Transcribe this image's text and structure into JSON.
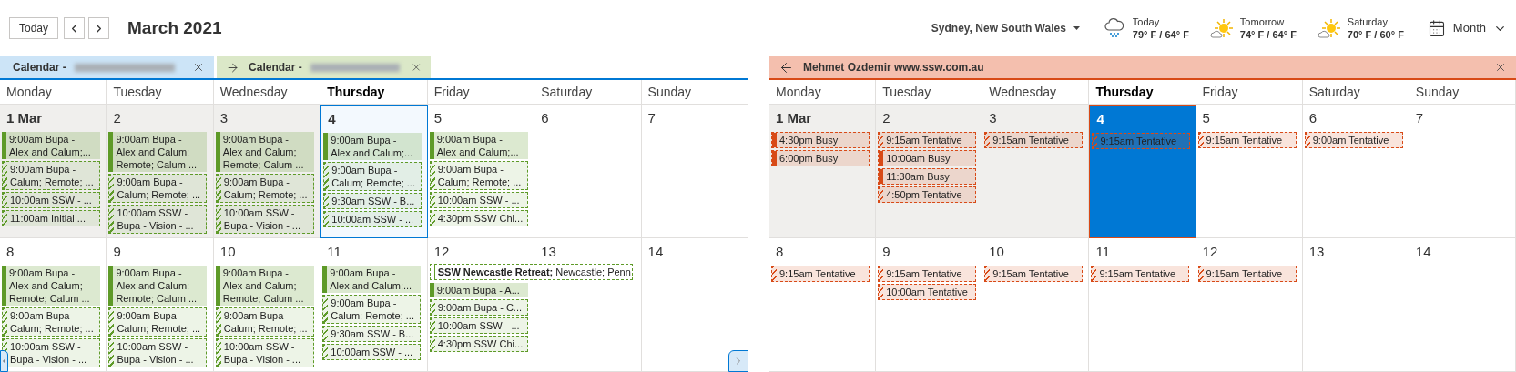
{
  "toolbar": {
    "today_button": "Today",
    "title": "March 2021",
    "location": "Sydney, New South Wales",
    "view": "Month",
    "weather": [
      {
        "kind": "rain",
        "day": "Today",
        "temps": "79° F / 64° F"
      },
      {
        "kind": "sun-cloud",
        "day": "Tomorrow",
        "temps": "74° F / 64° F"
      },
      {
        "kind": "sun-cloud",
        "day": "Saturday",
        "temps": "70° F / 60° F"
      }
    ]
  },
  "calendars": [
    {
      "kind": "overlay",
      "color": "#5e9a28",
      "tabs": [
        {
          "label": "Calendar - ",
          "color": "#cce4f7",
          "arrow": false,
          "redacted": true
        },
        {
          "label": "Calendar - ",
          "color": "#dbe8c8",
          "arrow": true,
          "redacted": true
        }
      ],
      "weekdays": [
        {
          "label": "Monday",
          "today": false
        },
        {
          "label": "Tuesday",
          "today": false
        },
        {
          "label": "Wednesday",
          "today": false
        },
        {
          "label": "Thursday",
          "today": true
        },
        {
          "label": "Friday",
          "today": false
        },
        {
          "label": "Saturday",
          "today": false
        },
        {
          "label": "Sunday",
          "today": false
        }
      ],
      "weeks": [
        [
          {
            "date": "1 Mar",
            "month_start": true,
            "past": true,
            "today": false,
            "events": [
              {
                "kind": "solid",
                "text": "9:00am Bupa -\nAlex and Calum;..."
              },
              {
                "kind": "tentative",
                "text": "9:00am Bupa -\nCalum; Remote; ..."
              },
              {
                "kind": "tentative",
                "text": "10:00am SSW - ..."
              },
              {
                "kind": "tentative",
                "text": "11:00am Initial ..."
              }
            ]
          },
          {
            "date": "2",
            "month_start": false,
            "past": true,
            "today": false,
            "events": [
              {
                "kind": "solid",
                "text": "9:00am Bupa -\nAlex and Calum;\nRemote; Calum ..."
              },
              {
                "kind": "tentative",
                "text": "9:00am Bupa -\nCalum; Remote; ..."
              },
              {
                "kind": "tentative",
                "text": "10:00am SSW -\nBupa - Vision - ..."
              }
            ]
          },
          {
            "date": "3",
            "month_start": false,
            "past": true,
            "today": false,
            "events": [
              {
                "kind": "solid",
                "text": "9:00am Bupa -\nAlex and Calum;\nRemote; Calum ..."
              },
              {
                "kind": "tentative",
                "text": "9:00am Bupa -\nCalum; Remote; ..."
              },
              {
                "kind": "tentative",
                "text": "10:00am SSW -\nBupa - Vision - ..."
              }
            ]
          },
          {
            "date": "4",
            "month_start": false,
            "past": false,
            "today": true,
            "events": [
              {
                "kind": "solid",
                "text": "9:00am Bupa -\nAlex and Calum;..."
              },
              {
                "kind": "tentative",
                "text": "9:00am Bupa -\nCalum; Remote; ..."
              },
              {
                "kind": "tentative",
                "text": "9:30am SSW - B..."
              },
              {
                "kind": "tentative",
                "text": "10:00am SSW - ..."
              }
            ]
          },
          {
            "date": "5",
            "month_start": false,
            "past": false,
            "today": false,
            "events": [
              {
                "kind": "solid",
                "text": "9:00am Bupa -\nAlex and Calum;..."
              },
              {
                "kind": "tentative",
                "text": "9:00am Bupa -\nCalum; Remote; ..."
              },
              {
                "kind": "tentative",
                "text": "10:00am SSW - ..."
              },
              {
                "kind": "tentative",
                "text": "4:30pm SSW Chi..."
              }
            ]
          },
          {
            "date": "6",
            "month_start": false,
            "past": false,
            "today": false
          },
          {
            "date": "7",
            "month_start": false,
            "past": false,
            "today": false
          }
        ],
        [
          {
            "date": "8",
            "month_start": false,
            "past": false,
            "today": false,
            "events": [
              {
                "kind": "solid",
                "text": "9:00am Bupa -\nAlex and Calum;\nRemote; Calum ..."
              },
              {
                "kind": "tentative",
                "text": "9:00am Bupa -\nCalum; Remote; ..."
              },
              {
                "kind": "tentative",
                "text": "10:00am SSW -\nBupa - Vision - ..."
              }
            ]
          },
          {
            "date": "9",
            "month_start": false,
            "past": false,
            "today": false,
            "events": [
              {
                "kind": "solid",
                "text": "9:00am Bupa -\nAlex and Calum;\nRemote; Calum ..."
              },
              {
                "kind": "tentative",
                "text": "9:00am Bupa -\nCalum; Remote; ..."
              },
              {
                "kind": "tentative",
                "text": "10:00am SSW -\nBupa - Vision - ..."
              }
            ]
          },
          {
            "date": "10",
            "month_start": false,
            "past": false,
            "today": false,
            "events": [
              {
                "kind": "solid",
                "text": "9:00am Bupa -\nAlex and Calum;\nRemote; Calum ..."
              },
              {
                "kind": "tentative",
                "text": "9:00am Bupa -\nCalum; Remote; ..."
              },
              {
                "kind": "tentative",
                "text": "10:00am SSW -\nBupa - Vision - ..."
              }
            ]
          },
          {
            "date": "11",
            "month_start": false,
            "past": false,
            "today": false,
            "events": [
              {
                "kind": "solid",
                "text": "9:00am Bupa -\nAlex and Calum;..."
              },
              {
                "kind": "tentative",
                "text": "9:00am Bupa -\nCalum; Remote; ..."
              },
              {
                "kind": "tentative",
                "text": "9:30am SSW - B..."
              },
              {
                "kind": "tentative",
                "text": "10:00am SSW - ..."
              }
            ]
          },
          {
            "date": "12",
            "month_start": false,
            "past": false,
            "today": false,
            "events": [
              {
                "kind": "allday",
                "text": "**SSW Newcastle Retreat;** Newcastle; Penn"
              },
              {
                "kind": "solid",
                "text": "9:00am Bupa - A..."
              },
              {
                "kind": "tentative",
                "text": "9:00am Bupa - C..."
              },
              {
                "kind": "tentative",
                "text": "10:00am SSW - ..."
              },
              {
                "kind": "tentative",
                "text": "4:30pm SSW Chi..."
              }
            ]
          },
          {
            "date": "13",
            "month_start": false,
            "past": false,
            "today": false
          },
          {
            "date": "14",
            "month_start": false,
            "past": false,
            "today": false
          }
        ]
      ]
    },
    {
      "kind": "shared",
      "color": "#d84a17",
      "tabs": [
        {
          "label": "Mehmet Ozdemir www.ssw.com.au",
          "color": "#f4bfae",
          "arrow": true,
          "redacted": false
        }
      ],
      "weekdays": [
        {
          "label": "Monday",
          "today": false
        },
        {
          "label": "Tuesday",
          "today": false
        },
        {
          "label": "Wednesday",
          "today": false
        },
        {
          "label": "Thursday",
          "today": true
        },
        {
          "label": "Friday",
          "today": false
        },
        {
          "label": "Saturday",
          "today": false
        },
        {
          "label": "Sunday",
          "today": false
        }
      ],
      "weeks": [
        [
          {
            "date": "1 Mar",
            "month_start": true,
            "past": true,
            "today": false,
            "events": [
              {
                "kind": "busy",
                "text": "4:30pm Busy"
              },
              {
                "kind": "busy",
                "text": "6:00pm Busy"
              }
            ]
          },
          {
            "date": "2",
            "month_start": false,
            "past": true,
            "today": false,
            "events": [
              {
                "kind": "tentative",
                "text": "9:15am Tentative"
              },
              {
                "kind": "busy",
                "text": "10:00am Busy"
              },
              {
                "kind": "busy",
                "text": "11:30am Busy"
              },
              {
                "kind": "tentative",
                "text": "4:50pm Tentative"
              }
            ]
          },
          {
            "date": "3",
            "month_start": false,
            "past": true,
            "today": false,
            "events": [
              {
                "kind": "tentative",
                "text": "9:15am Tentative"
              }
            ]
          },
          {
            "date": "4",
            "month_start": false,
            "past": false,
            "today": true,
            "events": [
              {
                "kind": "tentative",
                "text": "9:15am Tentative"
              }
            ]
          },
          {
            "date": "5",
            "month_start": false,
            "past": false,
            "today": false,
            "events": [
              {
                "kind": "tentative",
                "text": "9:15am Tentative"
              }
            ]
          },
          {
            "date": "6",
            "month_start": false,
            "past": false,
            "today": false,
            "events": [
              {
                "kind": "tentative",
                "text": "9:00am Tentative"
              }
            ]
          },
          {
            "date": "7",
            "month_start": false,
            "past": false,
            "today": false
          }
        ],
        [
          {
            "date": "8",
            "month_start": false,
            "past": false,
            "today": false,
            "events": [
              {
                "kind": "tentative",
                "text": "9:15am Tentative"
              }
            ]
          },
          {
            "date": "9",
            "month_start": false,
            "past": false,
            "today": false,
            "events": [
              {
                "kind": "tentative",
                "text": "9:15am Tentative"
              },
              {
                "kind": "tentative",
                "text": "10:00am Tentative"
              }
            ]
          },
          {
            "date": "10",
            "month_start": false,
            "past": false,
            "today": false,
            "events": [
              {
                "kind": "tentative",
                "text": "9:15am Tentative"
              }
            ]
          },
          {
            "date": "11",
            "month_start": false,
            "past": false,
            "today": false,
            "events": [
              {
                "kind": "tentative",
                "text": "9:15am Tentative"
              }
            ]
          },
          {
            "date": "12",
            "month_start": false,
            "past": false,
            "today": false,
            "events": [
              {
                "kind": "tentative",
                "text": "9:15am Tentative"
              }
            ]
          },
          {
            "date": "13",
            "month_start": false,
            "past": false,
            "today": false
          },
          {
            "date": "14",
            "month_start": false,
            "past": false,
            "today": false
          }
        ]
      ]
    }
  ]
}
